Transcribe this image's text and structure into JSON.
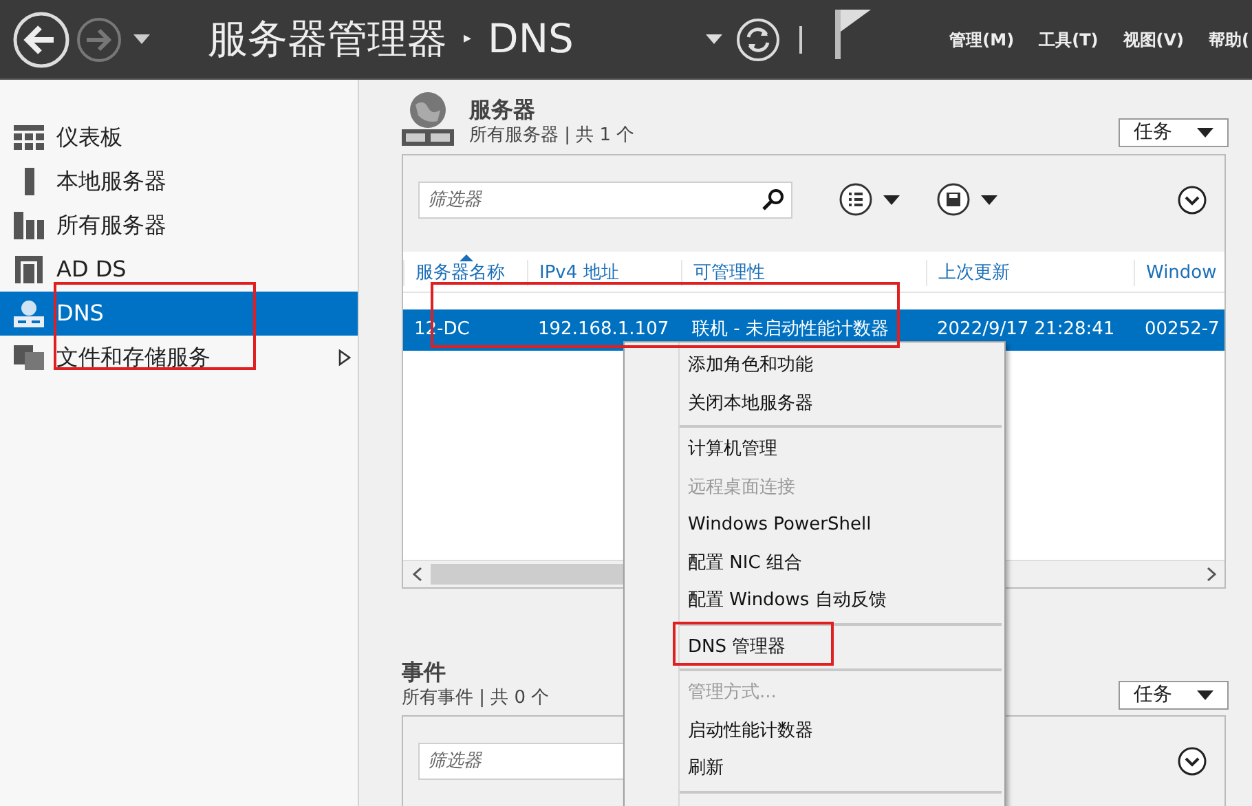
{
  "toolbar": {
    "title": "服务器管理器",
    "separator": "▸",
    "page": "DNS",
    "menus": [
      "管理(M)",
      "工具(T)",
      "视图(V)",
      "帮助("
    ]
  },
  "sidebar": {
    "items": [
      {
        "label": "仪表板",
        "selected": false,
        "has_submenu": false
      },
      {
        "label": "本地服务器",
        "selected": false,
        "has_submenu": false
      },
      {
        "label": "所有服务器",
        "selected": false,
        "has_submenu": false
      },
      {
        "label": "AD DS",
        "selected": false,
        "has_submenu": false
      },
      {
        "label": "DNS",
        "selected": true,
        "has_submenu": false
      },
      {
        "label": "文件和存储服务",
        "selected": false,
        "has_submenu": true
      }
    ]
  },
  "servers": {
    "title": "服务器",
    "subtitle": "所有服务器 | 共 1 个",
    "tasks_button": "任务",
    "filter": {
      "placeholder": "筛选器"
    },
    "columns": [
      "服务器名称",
      "IPv4 地址",
      "可管理性",
      "上次更新",
      "Window"
    ],
    "rows": [
      {
        "cells": [
          "12-DC",
          "192.168.1.107",
          "联机 - 未启动性能计数器",
          "2022/9/17 21:28:41",
          "00252-7"
        ],
        "selected": true
      }
    ]
  },
  "events": {
    "title": "事件",
    "subtitle": "所有事件 | 共 0 个",
    "tasks_button": "任务",
    "filter": {
      "placeholder": "筛选器"
    }
  },
  "context_menu": {
    "items": [
      {
        "kind": "item",
        "label": "添加角色和功能",
        "disabled": false
      },
      {
        "kind": "item",
        "label": "关闭本地服务器",
        "disabled": false
      },
      {
        "kind": "separator"
      },
      {
        "kind": "item",
        "label": "计算机管理",
        "disabled": false
      },
      {
        "kind": "item",
        "label": "远程桌面连接",
        "disabled": true
      },
      {
        "kind": "item",
        "label": "Windows PowerShell",
        "disabled": false
      },
      {
        "kind": "item",
        "label": "配置 NIC 组合",
        "disabled": false
      },
      {
        "kind": "item",
        "label": "配置 Windows 自动反馈",
        "disabled": false
      },
      {
        "kind": "separator"
      },
      {
        "kind": "item",
        "label": "DNS 管理器",
        "disabled": false
      },
      {
        "kind": "separator"
      },
      {
        "kind": "item",
        "label": "管理方式...",
        "disabled": true
      },
      {
        "kind": "item",
        "label": "启动性能计数器",
        "disabled": false
      },
      {
        "kind": "item",
        "label": "刷新",
        "disabled": false
      },
      {
        "kind": "separator"
      }
    ]
  },
  "annotations": [
    {
      "kind": "sidebar"
    },
    {
      "kind": "row"
    },
    {
      "kind": "menu"
    }
  ]
}
